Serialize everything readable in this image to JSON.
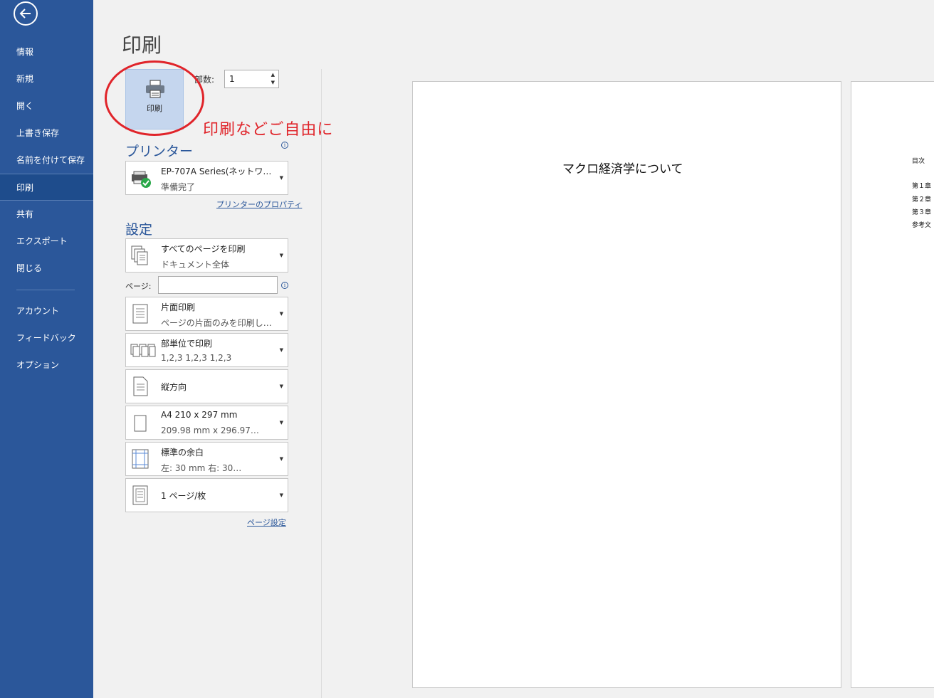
{
  "sidebar": {
    "items": [
      {
        "label": "情報"
      },
      {
        "label": "新規"
      },
      {
        "label": "開く"
      },
      {
        "label": "上書き保存"
      },
      {
        "label": "名前を付けて保存"
      },
      {
        "label": "印刷"
      },
      {
        "label": "共有"
      },
      {
        "label": "エクスポート"
      },
      {
        "label": "閉じる"
      },
      {
        "label": "アカウント"
      },
      {
        "label": "フィードバック"
      },
      {
        "label": "オプション"
      }
    ],
    "active": "印刷"
  },
  "main": {
    "title": "印刷",
    "print_button_label": "印刷",
    "copies_label": "部数:",
    "copies_value": "1",
    "annotation": "印刷などご自由に"
  },
  "printer": {
    "heading": "プリンター",
    "name": "EP-707A Series(ネットワ…",
    "status": "準備完了",
    "properties_link": "プリンターのプロパティ"
  },
  "settings": {
    "heading": "設定",
    "pages_label": "ページ:",
    "page_setup_link": "ページ設定",
    "items": [
      {
        "line1": "すべてのページを印刷",
        "line2": "ドキュメント全体"
      },
      {
        "line1": "片面印刷",
        "line2": "ページの片面のみを印刷し…"
      },
      {
        "line1": "部単位で印刷",
        "line2": "1,2,3    1,2,3    1,2,3"
      },
      {
        "line1": "縦方向",
        "line2": ""
      },
      {
        "line1": "A4 210 x 297 mm",
        "line2": "209.98 mm x 296.97…"
      },
      {
        "line1": "標準の余白",
        "line2": "左:  30 mm    右:  30…"
      },
      {
        "line1": "1 ページ/枚",
        "line2": ""
      }
    ]
  },
  "preview": {
    "page1_text": "マクロ経済学について",
    "page2_lines": [
      "目次",
      "第１章",
      "第２章",
      "第３章",
      "参考文"
    ]
  },
  "colors": {
    "sidebar": "#2b579a",
    "annotation": "#e0242a"
  }
}
